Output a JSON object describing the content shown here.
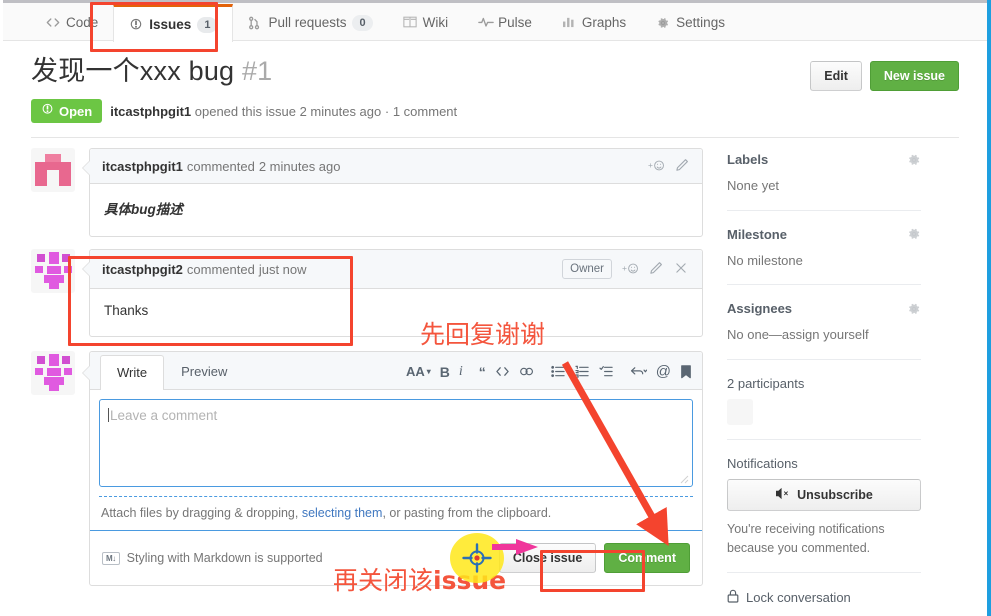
{
  "nav": {
    "tabs": [
      {
        "label": "Code",
        "icon": "code-icon",
        "count": null,
        "active": false
      },
      {
        "label": "Issues",
        "icon": "issue-opened-icon",
        "count": "1",
        "active": true
      },
      {
        "label": "Pull requests",
        "icon": "git-pull-request-icon",
        "count": "0",
        "active": false
      },
      {
        "label": "Wiki",
        "icon": "book-icon",
        "count": null,
        "active": false
      },
      {
        "label": "Pulse",
        "icon": "pulse-icon",
        "count": null,
        "active": false
      },
      {
        "label": "Graphs",
        "icon": "graph-icon",
        "count": null,
        "active": false
      },
      {
        "label": "Settings",
        "icon": "gear-icon",
        "count": null,
        "active": false
      }
    ]
  },
  "issue": {
    "title": "发现一个xxx bug",
    "number": "#1",
    "state": "Open",
    "author": "itcastphpgit1",
    "meta_opened": "opened this issue",
    "meta_when": "2 minutes ago",
    "meta_sep": "·",
    "meta_comments": "1 comment",
    "edit_label": "Edit",
    "new_issue_label": "New issue"
  },
  "comments": [
    {
      "author": "itcastphpgit1",
      "action": "commented",
      "when": "2 minutes ago",
      "body": "具体bug描述",
      "owner_badge": null,
      "cjk": true
    },
    {
      "author": "itcastphpgit2",
      "action": "commented",
      "when": "just now",
      "body": "Thanks",
      "owner_badge": "Owner",
      "cjk": false
    }
  ],
  "form": {
    "tab_write": "Write",
    "tab_preview": "Preview",
    "placeholder": "Leave a comment",
    "toolbar": [
      "heading-icon",
      "bold-icon",
      "italic-icon",
      "quote-icon",
      "code-icon",
      "link-icon",
      "unordered-list-icon",
      "ordered-list-icon",
      "task-list-icon",
      "reply-icon",
      "mention-icon",
      "saved-replies-icon"
    ],
    "attach_prefix": "Attach files by dragging & dropping, ",
    "attach_link": "selecting them",
    "attach_suffix": ", or pasting from the clipboard.",
    "markdown_badge": "M↓",
    "markdown_note": "Styling with Markdown is supported",
    "close_issue_label": "Close issue",
    "comment_label": "Comment"
  },
  "sidebar": {
    "labels_title": "Labels",
    "labels_value": "None yet",
    "milestone_title": "Milestone",
    "milestone_value": "No milestone",
    "assignees_title": "Assignees",
    "assignees_value": "No one—assign yourself",
    "participants_title": "2 participants",
    "notifications_title": "Notifications",
    "unsubscribe_label": "Unsubscribe",
    "notifications_note": "You're receiving notifications because you commented.",
    "lock_label": "Lock conversation"
  },
  "annotations": {
    "reply_first": "先回复谢谢",
    "then_close_cn": "再关闭该",
    "then_close_en": "issue"
  },
  "colors": {
    "accent_green": "#6cc644",
    "button_green": "#60b044",
    "tab_active_border": "#e36209",
    "annotation_red": "#f4442e",
    "highlight_yellow": "#ffe81a",
    "focus_blue": "#4a9ae0",
    "link_blue": "#4078c0"
  }
}
